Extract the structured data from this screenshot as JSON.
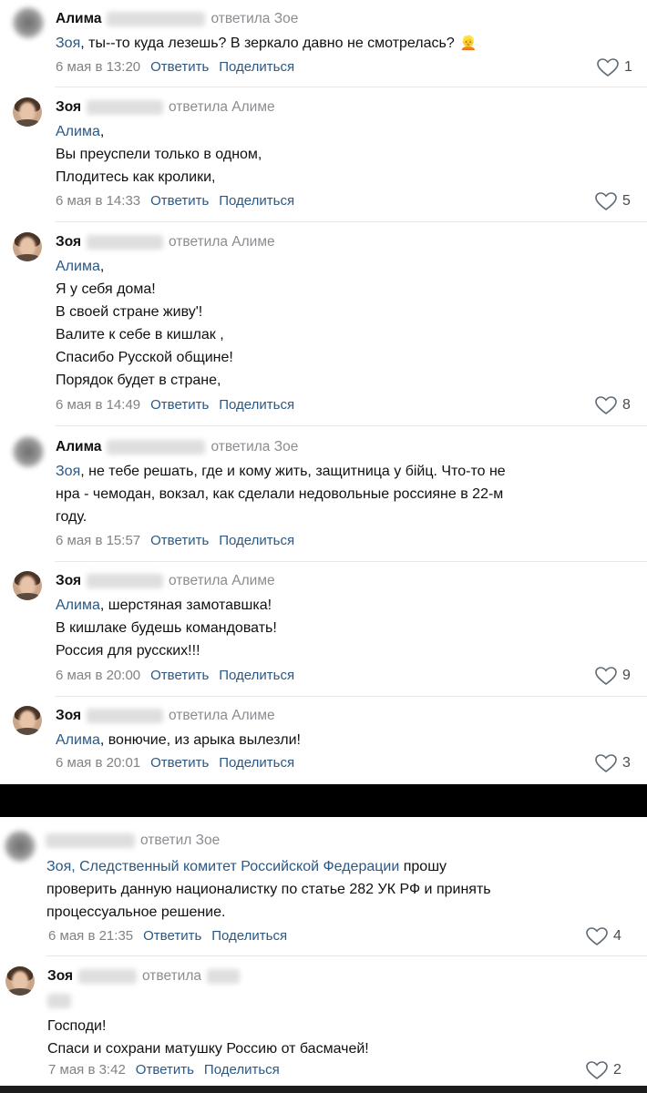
{
  "comments": [
    {
      "author": "Алима",
      "replied": "ответила Зое",
      "lines": [
        {
          "mention": "Зоя",
          "text": ", ты--то куда лезешь? В зеркало давно не смотрелась?"
        }
      ],
      "emoji": "👱",
      "date": "6 мая в 13:20",
      "reply": "Ответить",
      "share": "Поделиться",
      "likes": "1"
    },
    {
      "author": "Зоя",
      "replied": "ответила Алиме",
      "lines": [
        {
          "mention": "Алима",
          "text": ","
        },
        {
          "mention": "",
          "text": "Вы преуспели только в одном,"
        },
        {
          "mention": "",
          "text": "Плодитесь как кролики,"
        }
      ],
      "date": "6 мая в 14:33",
      "reply": "Ответить",
      "share": "Поделиться",
      "likes": "5"
    },
    {
      "author": "Зоя",
      "replied": "ответила Алиме",
      "lines": [
        {
          "mention": "Алима",
          "text": ","
        },
        {
          "mention": "",
          "text": "Я у себя дома!"
        },
        {
          "mention": "",
          "text": "В своей стране живу'!"
        },
        {
          "mention": "",
          "text": "Валите к себе в кишлак ,"
        },
        {
          "mention": "",
          "text": "Спасибо Русской общине!"
        },
        {
          "mention": "",
          "text": "Порядок будет в стране,"
        }
      ],
      "date": "6 мая в 14:49",
      "reply": "Ответить",
      "share": "Поделиться",
      "likes": "8"
    },
    {
      "author": "Алима",
      "replied": "ответила Зое",
      "lines": [
        {
          "mention": "Зоя",
          "text": ", не тебе решать, где и кому жить, защитница у бійц. Что-то не"
        },
        {
          "mention": "",
          "text": "нра - чемодан, вокзал, как сделали недовольные россияне в 22-м"
        },
        {
          "mention": "",
          "text": "году."
        }
      ],
      "date": "6 мая в 15:57",
      "reply": "Ответить",
      "share": "Поделиться",
      "likes": ""
    },
    {
      "author": "Зоя",
      "replied": "ответила Алиме",
      "lines": [
        {
          "mention": "Алима",
          "text": ", шерстяная замотавшка!"
        },
        {
          "mention": "",
          "text": "В кишлаке будешь командовать!"
        },
        {
          "mention": "",
          "text": "Россия для русских!!!"
        }
      ],
      "date": "6 мая в 20:00",
      "reply": "Ответить",
      "share": "Поделиться",
      "likes": "9"
    },
    {
      "author": "Зоя",
      "replied": "ответила Алиме",
      "lines": [
        {
          "mention": "Алима",
          "text": ", вонючие, из арыка вылезли!"
        }
      ],
      "date": "6 мая в 20:01",
      "reply": "Ответить",
      "share": "Поделиться",
      "likes": "3"
    },
    {
      "author": "",
      "replied": "ответил Зое",
      "lines": [
        {
          "mention": "Зоя, Следственный комитет Российской Федерации",
          "text": " прошу"
        },
        {
          "mention": "",
          "text": "проверить данную националистку по статье 282 УК РФ и принять"
        },
        {
          "mention": "",
          "text": "процессуальное решение."
        }
      ],
      "date": "6 мая в 21:35",
      "reply": "Ответить",
      "share": "Поделиться",
      "likes": "4"
    },
    {
      "author": "Зоя",
      "replied": "ответила",
      "lines": [
        {
          "mention": "",
          "text": "Господи!"
        },
        {
          "mention": "",
          "text": "Спаси и сохрани матушку Россию от басмачей!"
        }
      ],
      "date": "7 мая в 3:42",
      "reply": "Ответить",
      "share": "Поделиться",
      "likes": "2"
    }
  ],
  "colors": {
    "link": "#2a5885",
    "muted": "#828282",
    "separator": "#e7e8ec"
  }
}
